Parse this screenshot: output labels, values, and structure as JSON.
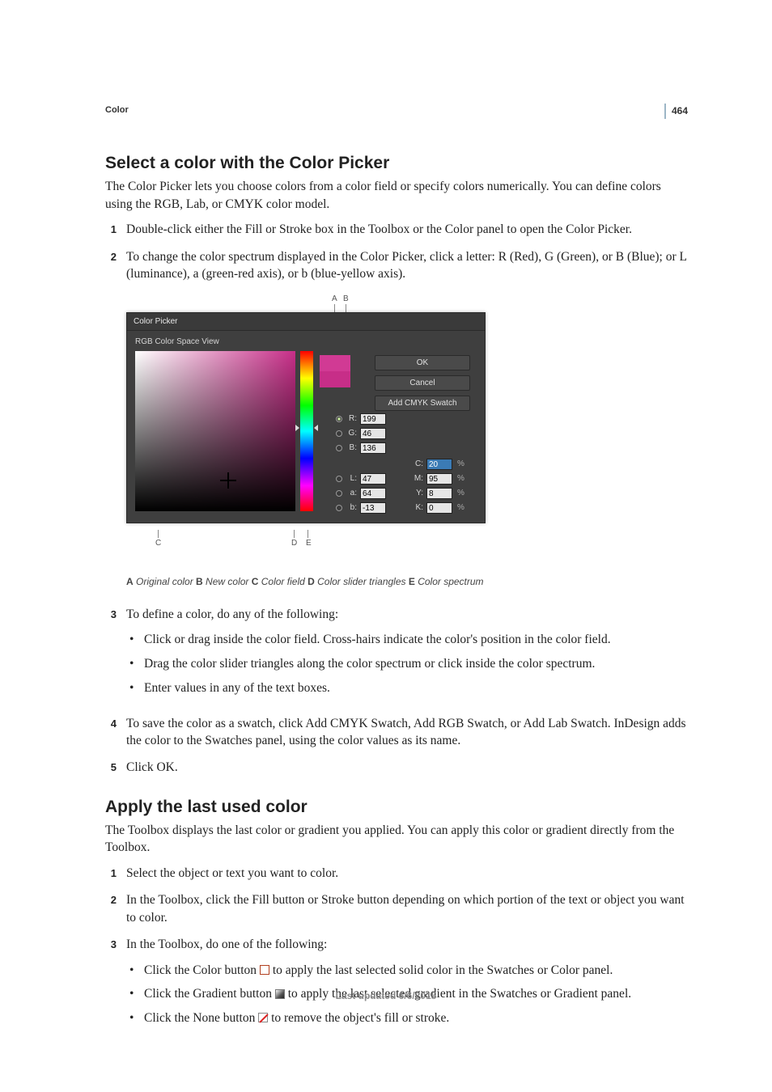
{
  "page": {
    "number": "464",
    "section": "Color",
    "lastUpdated": "Last updated 6/6/2015"
  },
  "s1": {
    "heading": "Select a color with the Color Picker",
    "intro": "The Color Picker lets you choose colors from a color field or specify colors numerically. You can define colors using the RGB, Lab, or CMYK color model.",
    "steps": {
      "n1": "1",
      "t1": "Double-click either the Fill or Stroke box in the Toolbox or the Color panel to open the Color Picker.",
      "n2": "2",
      "t2": "To change the color spectrum displayed in the Color Picker, click a letter: R (Red), G (Green), or B (Blue); or L (luminance), a (green-red axis), or b (blue-yellow axis).",
      "n3": "3",
      "t3": "To define a color, do any of the following:",
      "n4": "4",
      "t4": "To save the color as a swatch, click Add CMYK Swatch, Add RGB Swatch, or Add Lab Swatch. InDesign adds the color to the Swatches panel, using the color values as its name.",
      "n5": "5",
      "t5": "Click OK."
    },
    "bullets3": {
      "b1": "Click or drag inside the color field. Cross-hairs indicate the color's position in the color field.",
      "b2": "Drag the color slider triangles along the color spectrum or click inside the color spectrum.",
      "b3": "Enter values in any of the text boxes."
    }
  },
  "fig": {
    "dialogTitle": "Color Picker",
    "sub": "RGB Color Space View",
    "btn": {
      "ok": "OK",
      "cancel": "Cancel",
      "add": "Add CMYK Swatch"
    },
    "topA": "A",
    "topB": "B",
    "botC": "C",
    "botD": "D",
    "botE": "E",
    "vals": {
      "R_l": "R:",
      "R": "199",
      "G_l": "G:",
      "G": "46",
      "B_l": "B:",
      "B": "136",
      "L_l": "L:",
      "L": "47",
      "a_l": "a:",
      "a": "64",
      "b_l": "b:",
      "b": "-13",
      "C_l": "C:",
      "C": "20",
      "M_l": "M:",
      "M": "95",
      "Y_l": "Y:",
      "Y": "8",
      "K_l": "K:",
      "K": "0",
      "pct": "%"
    },
    "swatchNew": "#c72e88",
    "swatchOld": "#c72e88",
    "caption": {
      "A_b": "A",
      "A_t": " Original color  ",
      "B_b": "B",
      "B_t": " New color  ",
      "C_b": "C",
      "C_t": " Color field  ",
      "D_b": "D",
      "D_t": " Color slider triangles  ",
      "E_b": "E",
      "E_t": " Color spectrum"
    }
  },
  "s2": {
    "heading": "Apply the last used color",
    "intro": "The Toolbox displays the last color or gradient you applied. You can apply this color or gradient directly from the Toolbox.",
    "steps": {
      "n1": "1",
      "t1": "Select the object or text you want to color.",
      "n2": "2",
      "t2": "In the Toolbox, click the Fill button or Stroke button depending on which portion of the text or object you want to color.",
      "n3": "3",
      "t3": "In the Toolbox, do one of the following:"
    },
    "bullets3": {
      "b1a": "Click the Color button ",
      "b1b": " to apply the last selected solid color in the Swatches or Color panel.",
      "b2a": "Click the Gradient button ",
      "b2b": " to apply the last selected gradient in the Swatches or Gradient panel.",
      "b3a": "Click the None button ",
      "b3b": " to remove the object's fill or stroke."
    }
  }
}
